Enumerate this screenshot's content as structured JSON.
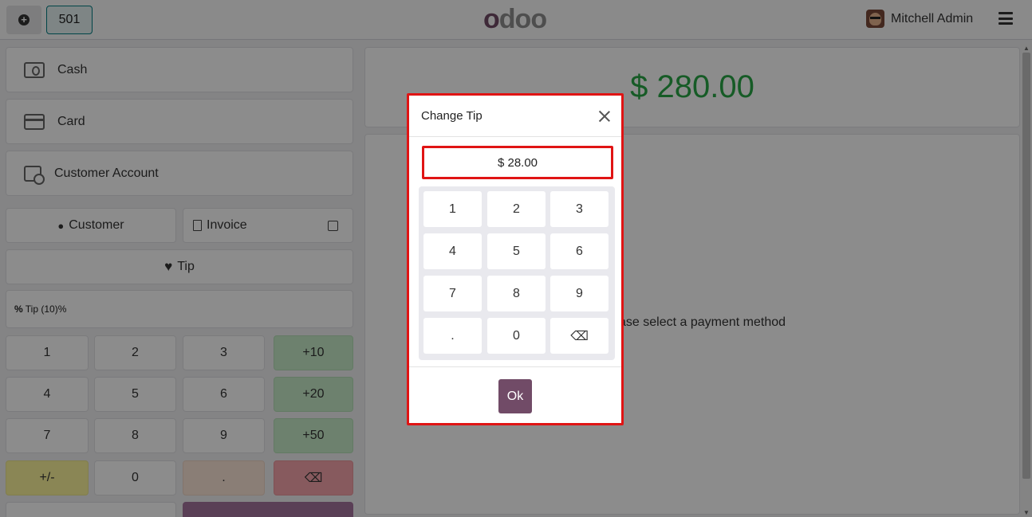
{
  "header": {
    "order_number": "501",
    "logo": "odoo",
    "user_name": "Mitchell Admin"
  },
  "payment_methods": [
    {
      "label": "Cash",
      "icon": "cash-icon"
    },
    {
      "label": "Card",
      "icon": "card-icon"
    },
    {
      "label": "Customer Account",
      "icon": "customer-account-icon"
    }
  ],
  "controls": {
    "customer_label": "Customer",
    "invoice_label": "Invoice",
    "tip_label": "Tip",
    "tip_line": "Tip (10)%",
    "tip_line_prefix": "%"
  },
  "keypad": {
    "k1": "1",
    "k2": "2",
    "k3": "3",
    "p10": "+10",
    "k4": "4",
    "k5": "5",
    "k6": "6",
    "p20": "+20",
    "k7": "7",
    "k8": "8",
    "k9": "9",
    "p50": "+50",
    "sign": "+/-",
    "k0": "0",
    "dot": ".",
    "back": "⌫"
  },
  "summary": {
    "total": "$ 280.00",
    "message": "ase select a payment method"
  },
  "dialog": {
    "title": "Change Tip",
    "amount": "$ 28.00",
    "keys": [
      "1",
      "2",
      "3",
      "4",
      "5",
      "6",
      "7",
      "8",
      "9",
      ".",
      "0",
      "⌫"
    ],
    "ok_label": "Ok"
  },
  "colors": {
    "brand": "#714b67",
    "total_green": "#28a745",
    "highlight_red": "#e01414"
  }
}
